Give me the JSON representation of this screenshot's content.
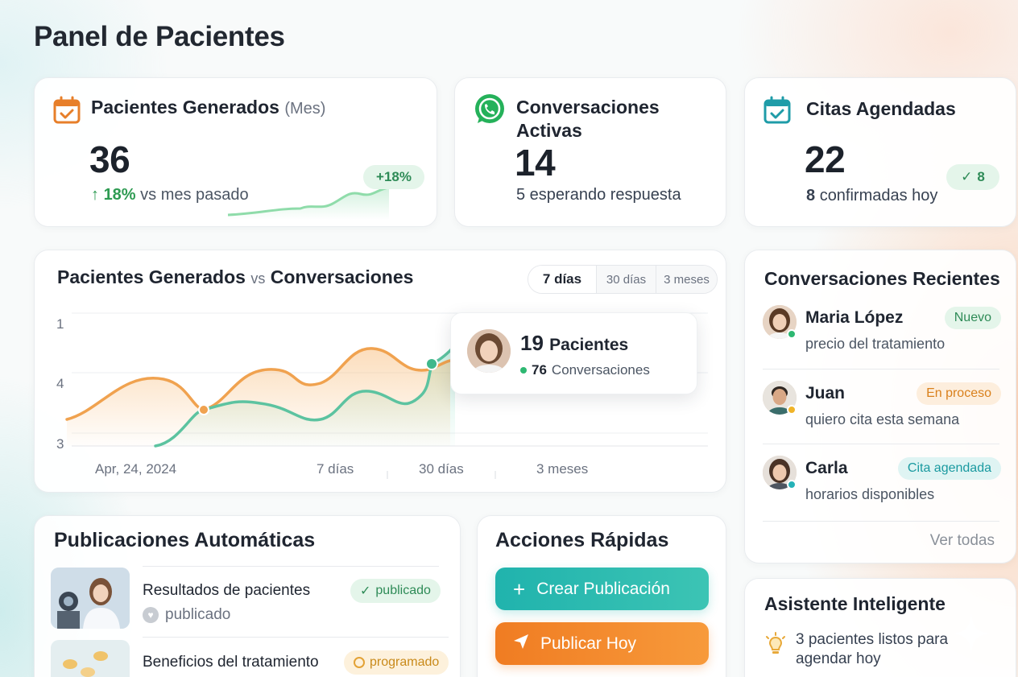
{
  "page": {
    "title": "Panel de Pacientes"
  },
  "stats": {
    "patients": {
      "title": "Pacientes Generados",
      "title_suffix": "(Mes)",
      "value": "36",
      "change": "18%",
      "change_text": "vs mes pasado",
      "badge": "+18%",
      "icon": "calendar-check-icon",
      "color": "#e77f2a"
    },
    "conversations": {
      "title": "Conversaciones Activas",
      "value": "14",
      "sub": "5 esperando respuesta",
      "icon": "whatsapp-icon",
      "color": "#25b15a"
    },
    "appointments": {
      "title": "Citas Agendadas",
      "value": "22",
      "sub_count": "8",
      "sub_text": "confirmadas hoy",
      "badge": "8",
      "icon": "calendar-check-icon",
      "color": "#1f9ca8"
    }
  },
  "chart": {
    "title_a": "Pacientes Generados",
    "title_vs": "vs",
    "title_b": "Conversaciones",
    "ranges": [
      "7 días",
      "30 días",
      "3 meses"
    ],
    "active_range": "7 días",
    "tooltip": {
      "value": "19",
      "label": "Pacientes",
      "sub_value": "76",
      "sub_label": "Conversaciones"
    }
  },
  "chart_data": {
    "type": "area",
    "y_tick_labels": [
      "1",
      "4",
      "3"
    ],
    "x_tick_labels": [
      "Apr, 24, 2024",
      "7 días",
      "30 días",
      "3 meses"
    ],
    "series": [
      {
        "color": "#f0a24f"
      },
      {
        "color": "#5cc3a0"
      }
    ],
    "annotation": "19 Pacientes · 76 Conversaciones",
    "grid": true
  },
  "recent": {
    "title": "Conversaciones Recientes",
    "items": [
      {
        "name": "Maria López",
        "message": "precio del tratamiento",
        "badge": "Nuevo",
        "badge_color": "#2e8b57",
        "badge_bg": "#e4f5ea",
        "dot": "#2eb872"
      },
      {
        "name": "Juan",
        "message": "quiero cita esta semana",
        "badge": "En proceso",
        "badge_color": "#d9801c",
        "badge_bg": "#fdeedd",
        "dot": "#f0b429"
      },
      {
        "name": "Carla",
        "message": "horarios disponibles",
        "badge": "Cita agendada",
        "badge_color": "#1a9aa0",
        "badge_bg": "#dff4f3",
        "dot": "#25b2b8"
      }
    ],
    "view_all": "Ver todas"
  },
  "publications": {
    "title": "Publicaciones Automáticas",
    "items": [
      {
        "title": "Resultados de pacientes",
        "status": "publicado",
        "badge": "publicado"
      },
      {
        "title": "Beneficios del tratamiento",
        "badge": "programado"
      }
    ]
  },
  "quick_actions": {
    "title": "Acciones Rápidas",
    "create": "Crear Publicación",
    "publish": "Publicar Hoy"
  },
  "assistant": {
    "title": "Asistente Inteligente",
    "text": "3 pacientes listos para agendar hoy"
  }
}
